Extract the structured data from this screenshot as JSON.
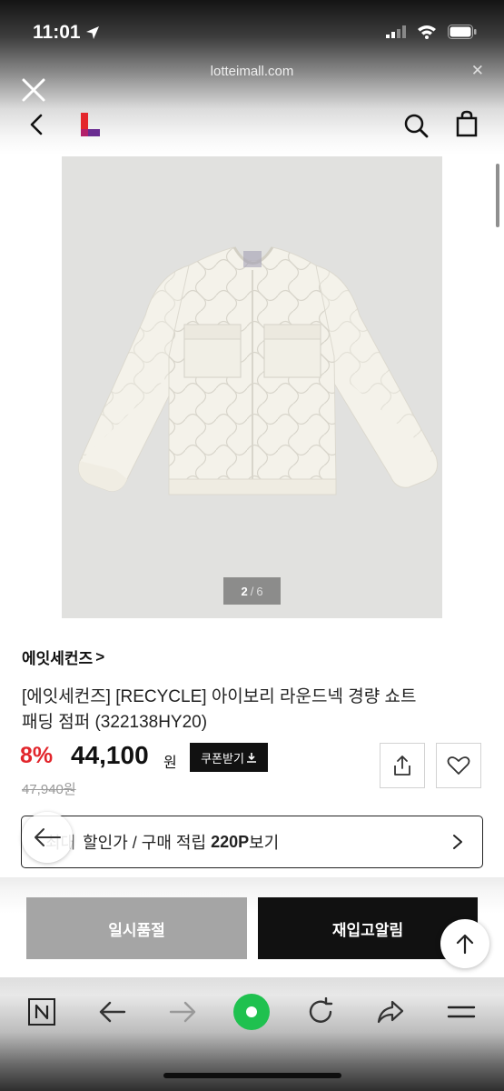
{
  "status_bar": {
    "time": "11:01"
  },
  "browser": {
    "url": "lotteimall.com"
  },
  "product": {
    "image_counter": {
      "current": "2",
      "separator": "/",
      "total": "6"
    },
    "brand": "에잇세컨즈",
    "brand_chevron": ">",
    "title": "[에잇세컨즈] [RECYCLE] 아이보리 라운드넥 경량 쇼트 패딩 점퍼 (322138HY20)",
    "discount": "8%",
    "price": "44,100",
    "price_unit": "원",
    "coupon_label": "쿠폰받기",
    "original_price": "47,940원"
  },
  "benefit": {
    "prefix": "최대",
    "text": "할인가 / 구매 적립",
    "points": "220P",
    "suffix": "보기"
  },
  "actions": {
    "soldout_label": "일시품절",
    "restock_label": "재입고알림"
  },
  "colors": {
    "accent": "#e2262c",
    "brand_logo_red": "#e4262c",
    "brand_logo_purple": "#6a2c91",
    "button_dark": "#111111",
    "button_gray": "#a5a5a5",
    "naver_green": "#1fc14f"
  },
  "icons": [
    "location-arrow-icon",
    "signal-icon",
    "wifi-icon",
    "battery-icon",
    "close-icon",
    "back-icon",
    "search-icon",
    "shopping-bag-icon",
    "download-icon",
    "share-icon",
    "heart-icon",
    "chevron-right-icon",
    "arrow-left-icon",
    "arrow-up-icon",
    "naver-n-icon",
    "arrow-right-icon",
    "green-circle-icon",
    "refresh-icon",
    "share-arrow-icon",
    "menu-icon"
  ]
}
